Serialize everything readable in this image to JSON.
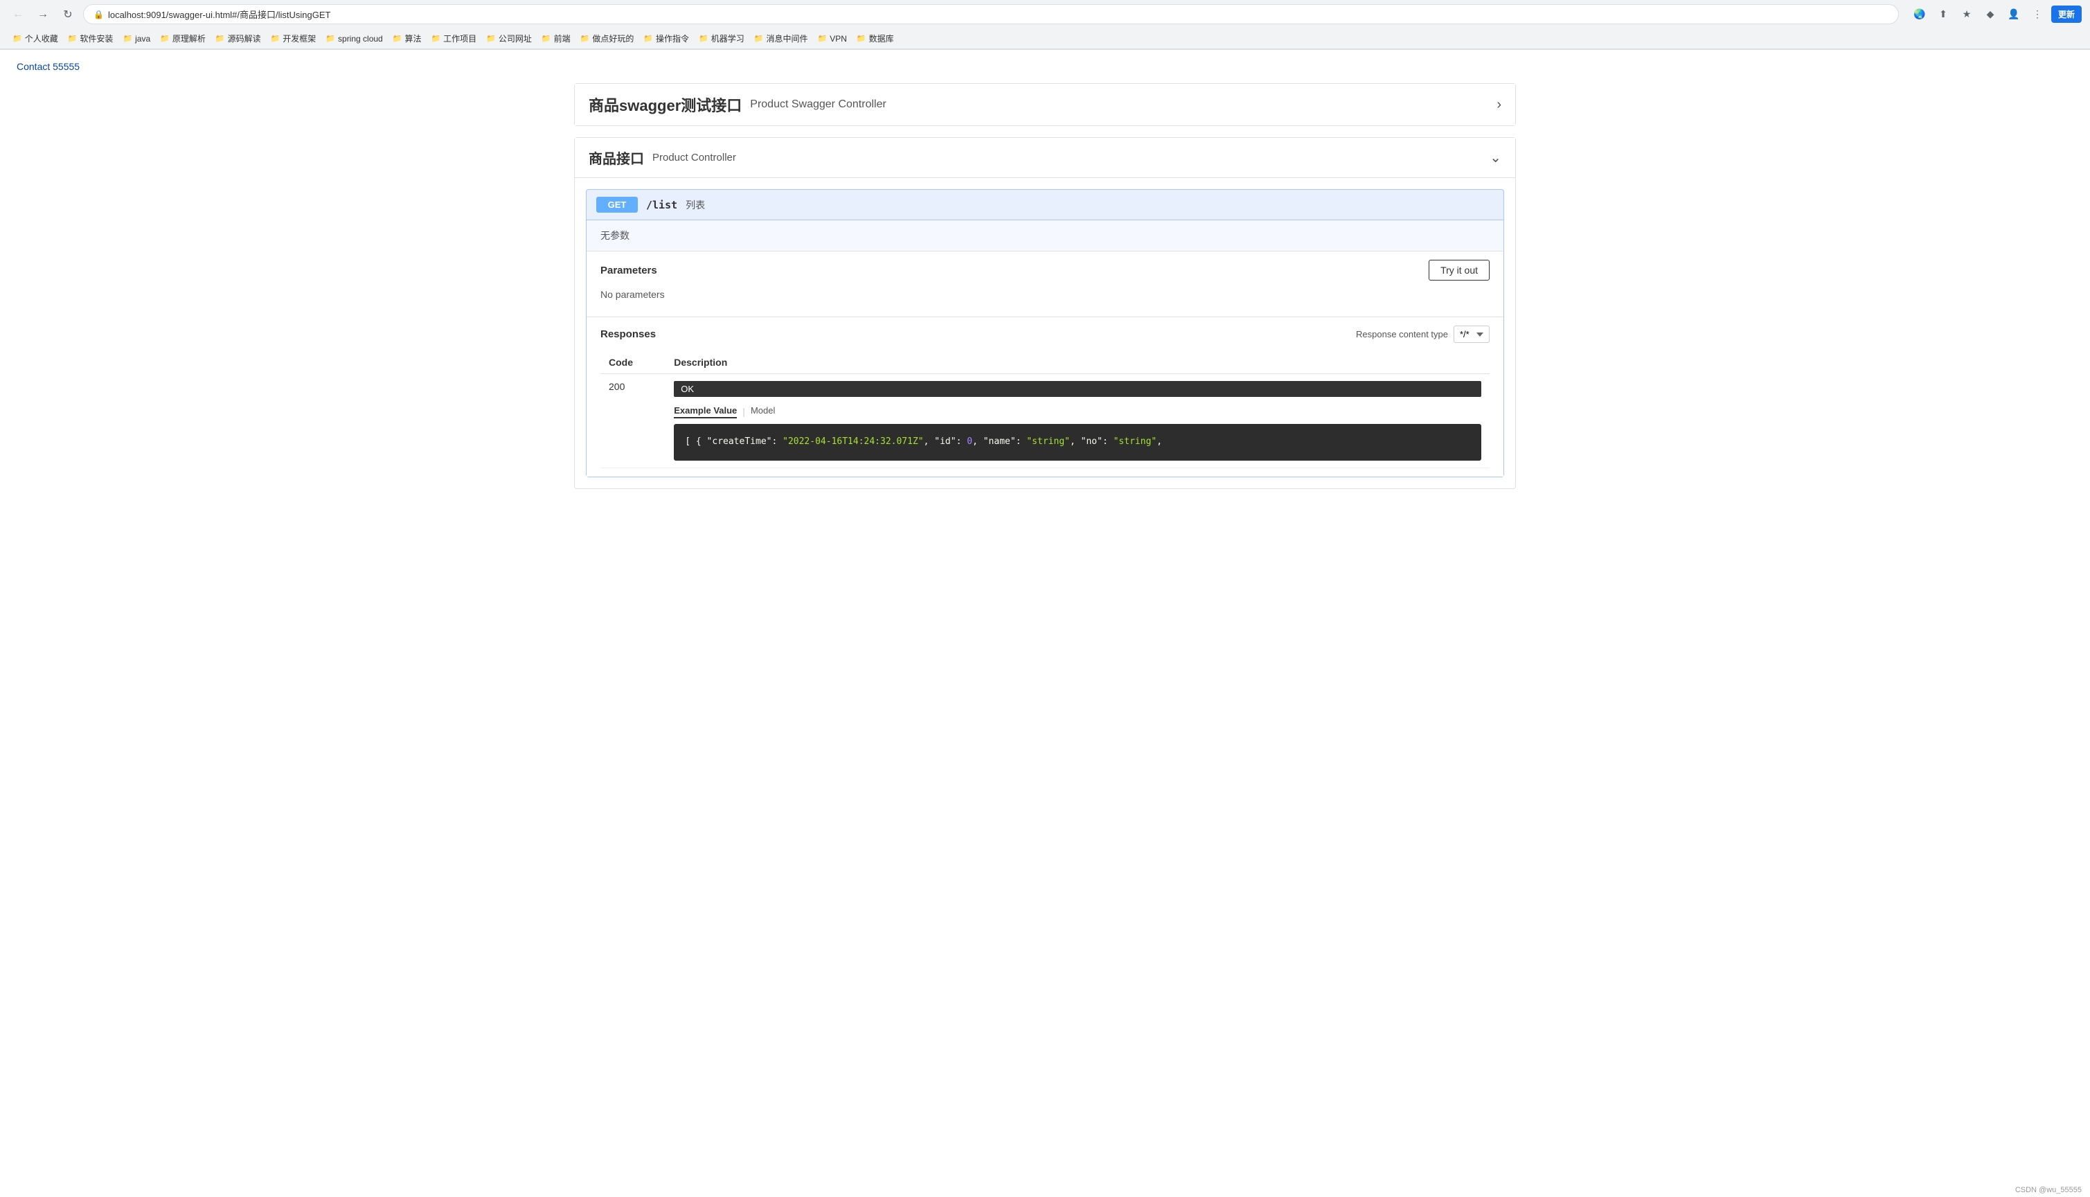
{
  "browser": {
    "url": "localhost:9091/swagger-ui.html#/商品接口/listUsingGET",
    "update_label": "更新"
  },
  "bookmarks": [
    {
      "label": "个人收藏"
    },
    {
      "label": "软件安装"
    },
    {
      "label": "java"
    },
    {
      "label": "原理解析"
    },
    {
      "label": "源码解读"
    },
    {
      "label": "开发框架"
    },
    {
      "label": "spring cloud"
    },
    {
      "label": "算法"
    },
    {
      "label": "工作项目"
    },
    {
      "label": "公司网址"
    },
    {
      "label": "前端"
    },
    {
      "label": "做点好玩的"
    },
    {
      "label": "操作指令"
    },
    {
      "label": "机器学习"
    },
    {
      "label": "消息中间件"
    },
    {
      "label": "VPN"
    },
    {
      "label": "数据库"
    }
  ],
  "contact_link": "Contact 55555",
  "swagger": {
    "product_swagger": {
      "title": "商品swagger测试接口",
      "subtitle": "Product Swagger Controller"
    },
    "product_controller": {
      "title": "商品接口",
      "subtitle": "Product Controller"
    },
    "endpoint": {
      "method": "GET",
      "path": "/list",
      "desc": "列表",
      "no_params": "无参数",
      "parameters_title": "Parameters",
      "try_it_out_label": "Try it out",
      "no_parameters": "No parameters",
      "responses_title": "Responses",
      "response_content_type_label": "Response content type",
      "response_content_type_value": "*/*",
      "response_code_col": "Code",
      "response_desc_col": "Description",
      "response_code_200": "200",
      "ok_label": "OK",
      "example_value_label": "Example Value",
      "model_label": "Model",
      "json_content": "[\n  {\n    \"createTime\": \"2022-04-16T14:24:32.071Z\",\n    \"id\": 0,\n    \"name\": \"string\",\n    \"no\": \"string\","
    }
  },
  "footer": {
    "text": "CSDN @wu_55555"
  }
}
